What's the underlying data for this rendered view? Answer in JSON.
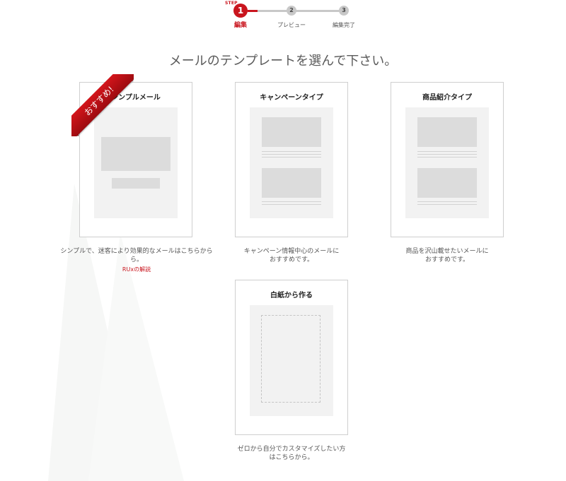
{
  "stepper": {
    "tag": "STEP",
    "steps": [
      {
        "number": "1",
        "label": "編集",
        "state": "active"
      },
      {
        "number": "2",
        "label": "プレビュー",
        "state": "inactive"
      },
      {
        "number": "3",
        "label": "編集完了",
        "state": "inactive"
      }
    ]
  },
  "heading": "メールのテンプレートを選んで下さい。",
  "templates": [
    {
      "title": "シンプルメール",
      "badge": "おすすめ!",
      "description_line1": "シンプルで、迷客により効果的なメールはこちらから",
      "description_line2": "ら。",
      "link": "RUxの解説"
    },
    {
      "title": "キャンペーンタイプ",
      "description_line1": "キャンペーン情報中心のメールに",
      "description_line2": "おすすめです。"
    },
    {
      "title": "商品紹介タイプ",
      "description_line1": "商品を沢山載せたいメールに",
      "description_line2": "おすすめです。"
    },
    {
      "title": "白紙から作る",
      "description_line1": "ゼロから自分でカスタマイズしたい方",
      "description_line2": "はこちらから。"
    }
  ],
  "colors": {
    "accent": "#c9151e",
    "inactive_step": "#c8c8c8",
    "thumb_bg": "#f2f2f2",
    "thumb_block": "#dcdcdc"
  }
}
